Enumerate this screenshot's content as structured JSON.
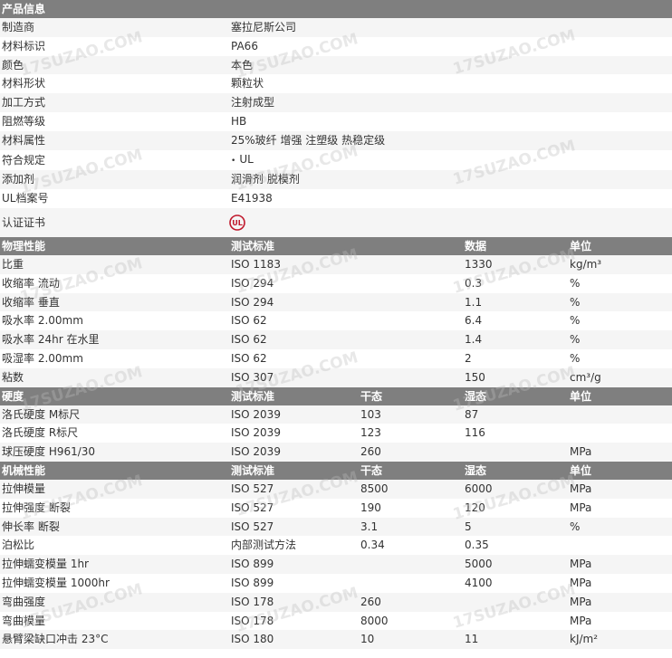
{
  "watermark_text": "17SUZAO.COM",
  "colors": {
    "header_bg": "#7f7f7f",
    "odd_row_bg": "#f5f5f5",
    "text": "#333333",
    "ul_mark": "#c0182c"
  },
  "product_info": {
    "header": "产品信息",
    "rows": [
      {
        "label": "制造商",
        "value": "塞拉尼斯公司"
      },
      {
        "label": "材料标识",
        "value": "PA66"
      },
      {
        "label": "颜色",
        "value": "本色"
      },
      {
        "label": "材料形状",
        "value": "颗粒状"
      },
      {
        "label": "加工方式",
        "value": "注射成型"
      },
      {
        "label": "阻燃等级",
        "value": "HB"
      },
      {
        "label": "材料属性",
        "value": "25%玻纤 增强 注塑级 热稳定级"
      },
      {
        "label": "符合规定",
        "value": "UL"
      },
      {
        "label": "添加剂",
        "value": "润滑剂 脱模剂"
      },
      {
        "label": "UL档案号",
        "value": "E41938"
      }
    ],
    "cert_label": "认证证书",
    "cert_icon": "ul-certification-icon"
  },
  "physical": {
    "header": [
      "物理性能",
      "测试标准",
      "",
      "数据",
      "单位"
    ],
    "rows": [
      [
        "比重",
        "ISO 1183",
        "",
        "1330",
        "kg/m³"
      ],
      [
        "收缩率   流动",
        "ISO 294",
        "",
        "0.3",
        "%"
      ],
      [
        "收缩率   垂直",
        "ISO 294",
        "",
        "1.1",
        "%"
      ],
      [
        "吸水率   2.00mm",
        "ISO 62",
        "",
        "6.4",
        "%"
      ],
      [
        "吸水率   24hr 在水里",
        "ISO 62",
        "",
        "1.4",
        "%"
      ],
      [
        "吸湿率   2.00mm",
        "ISO 62",
        "",
        "2",
        "%"
      ],
      [
        "粘数",
        "ISO 307",
        "",
        "150",
        "cm³/g"
      ]
    ]
  },
  "hardness": {
    "header": [
      "硬度",
      "测试标准",
      "干态",
      "湿态",
      "单位"
    ],
    "rows": [
      [
        "洛氏硬度   M标尺",
        "ISO 2039",
        "103",
        "87",
        ""
      ],
      [
        "洛氏硬度   R标尺",
        "ISO 2039",
        "123",
        "116",
        ""
      ],
      [
        "球压硬度   H961/30",
        "ISO 2039",
        "260",
        "",
        "MPa"
      ]
    ]
  },
  "mechanical": {
    "header": [
      "机械性能",
      "测试标准",
      "干态",
      "湿态",
      "单位"
    ],
    "rows": [
      [
        "拉伸模量",
        "ISO 527",
        "8500",
        "6000",
        "MPa"
      ],
      [
        "拉伸强度   断裂",
        "ISO 527",
        "190",
        "120",
        "MPa"
      ],
      [
        "伸长率   断裂",
        "ISO 527",
        "3.1",
        "5",
        "%"
      ],
      [
        "泊松比",
        "内部测试方法",
        "0.34",
        "0.35",
        ""
      ],
      [
        "拉伸蠕变模量   1hr",
        "ISO 899",
        "",
        "5000",
        "MPa"
      ],
      [
        "拉伸蠕变模量   1000hr",
        "ISO 899",
        "",
        "4100",
        "MPa"
      ],
      [
        "弯曲强度",
        "ISO 178",
        "260",
        "",
        "MPa"
      ],
      [
        "弯曲模量",
        "ISO 178",
        "8000",
        "",
        "MPa"
      ],
      [
        "悬臂梁缺口冲击   23°C",
        "ISO 180",
        "10",
        "11",
        "kJ/m²"
      ]
    ]
  }
}
